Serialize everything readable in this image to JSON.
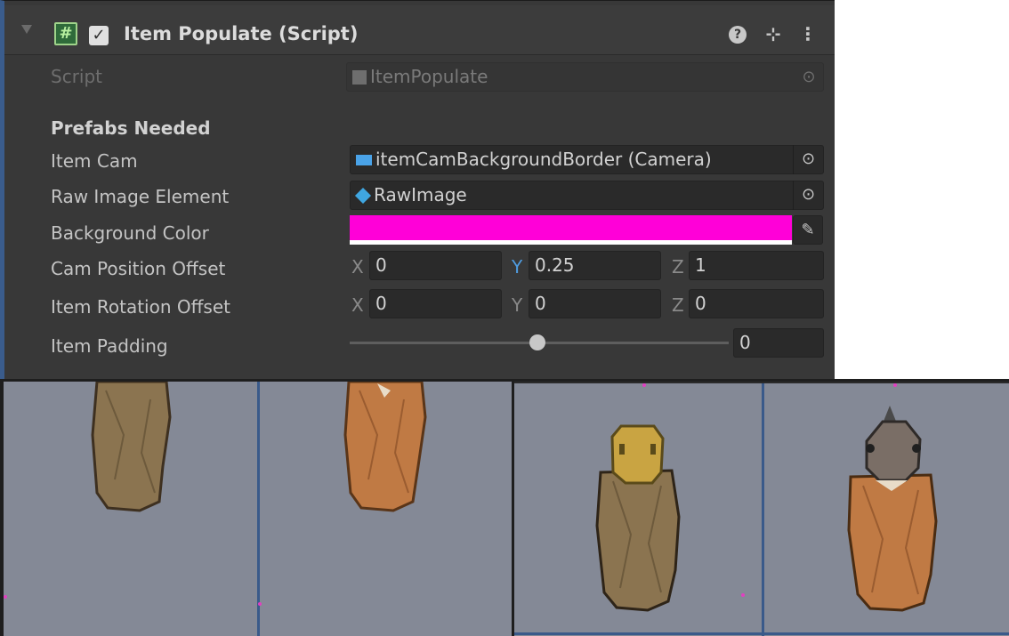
{
  "component": {
    "title": "Item Populate (Script)",
    "script_icon": "#",
    "enabled_check": "✓",
    "help_icon": "?",
    "presets_icon": "⊹",
    "menu_icon": "⋮"
  },
  "fields": {
    "script_label": "Script",
    "script_value": "ItemPopulate",
    "section_header": "Prefabs Needed",
    "item_cam_label": "Item Cam",
    "item_cam_value": "itemCamBackgroundBorder (Camera)",
    "raw_image_label": "Raw Image Element",
    "raw_image_value": "RawImage",
    "bg_color_label": "Background Color",
    "bg_color_hex": "#ff00d8",
    "cam_pos_label": "Cam Position Offset",
    "cam_pos": {
      "x_label": "X",
      "x": "0",
      "y_label": "Y",
      "y": "0.25",
      "z_label": "Z",
      "z": "1"
    },
    "item_rot_label": "Item Rotation Offset",
    "item_rot": {
      "x_label": "X",
      "x": "0",
      "y_label": "Y",
      "y": "0",
      "z_label": "Z",
      "z": "0"
    },
    "padding_label": "Item Padding",
    "padding_value": "0",
    "padding_slider_fraction": 0.5
  },
  "icons": {
    "object_picker": "⊙",
    "eyedropper": "✎",
    "camera": "camera-icon",
    "prefab": "cube-icon",
    "script": "script-icon"
  },
  "colors": {
    "panel_bg": "#383838",
    "accent_blue": "#4f9ce0",
    "viewport_bg": "#848996",
    "item_brown": "#8b7450",
    "item_orange": "#c07a44"
  }
}
